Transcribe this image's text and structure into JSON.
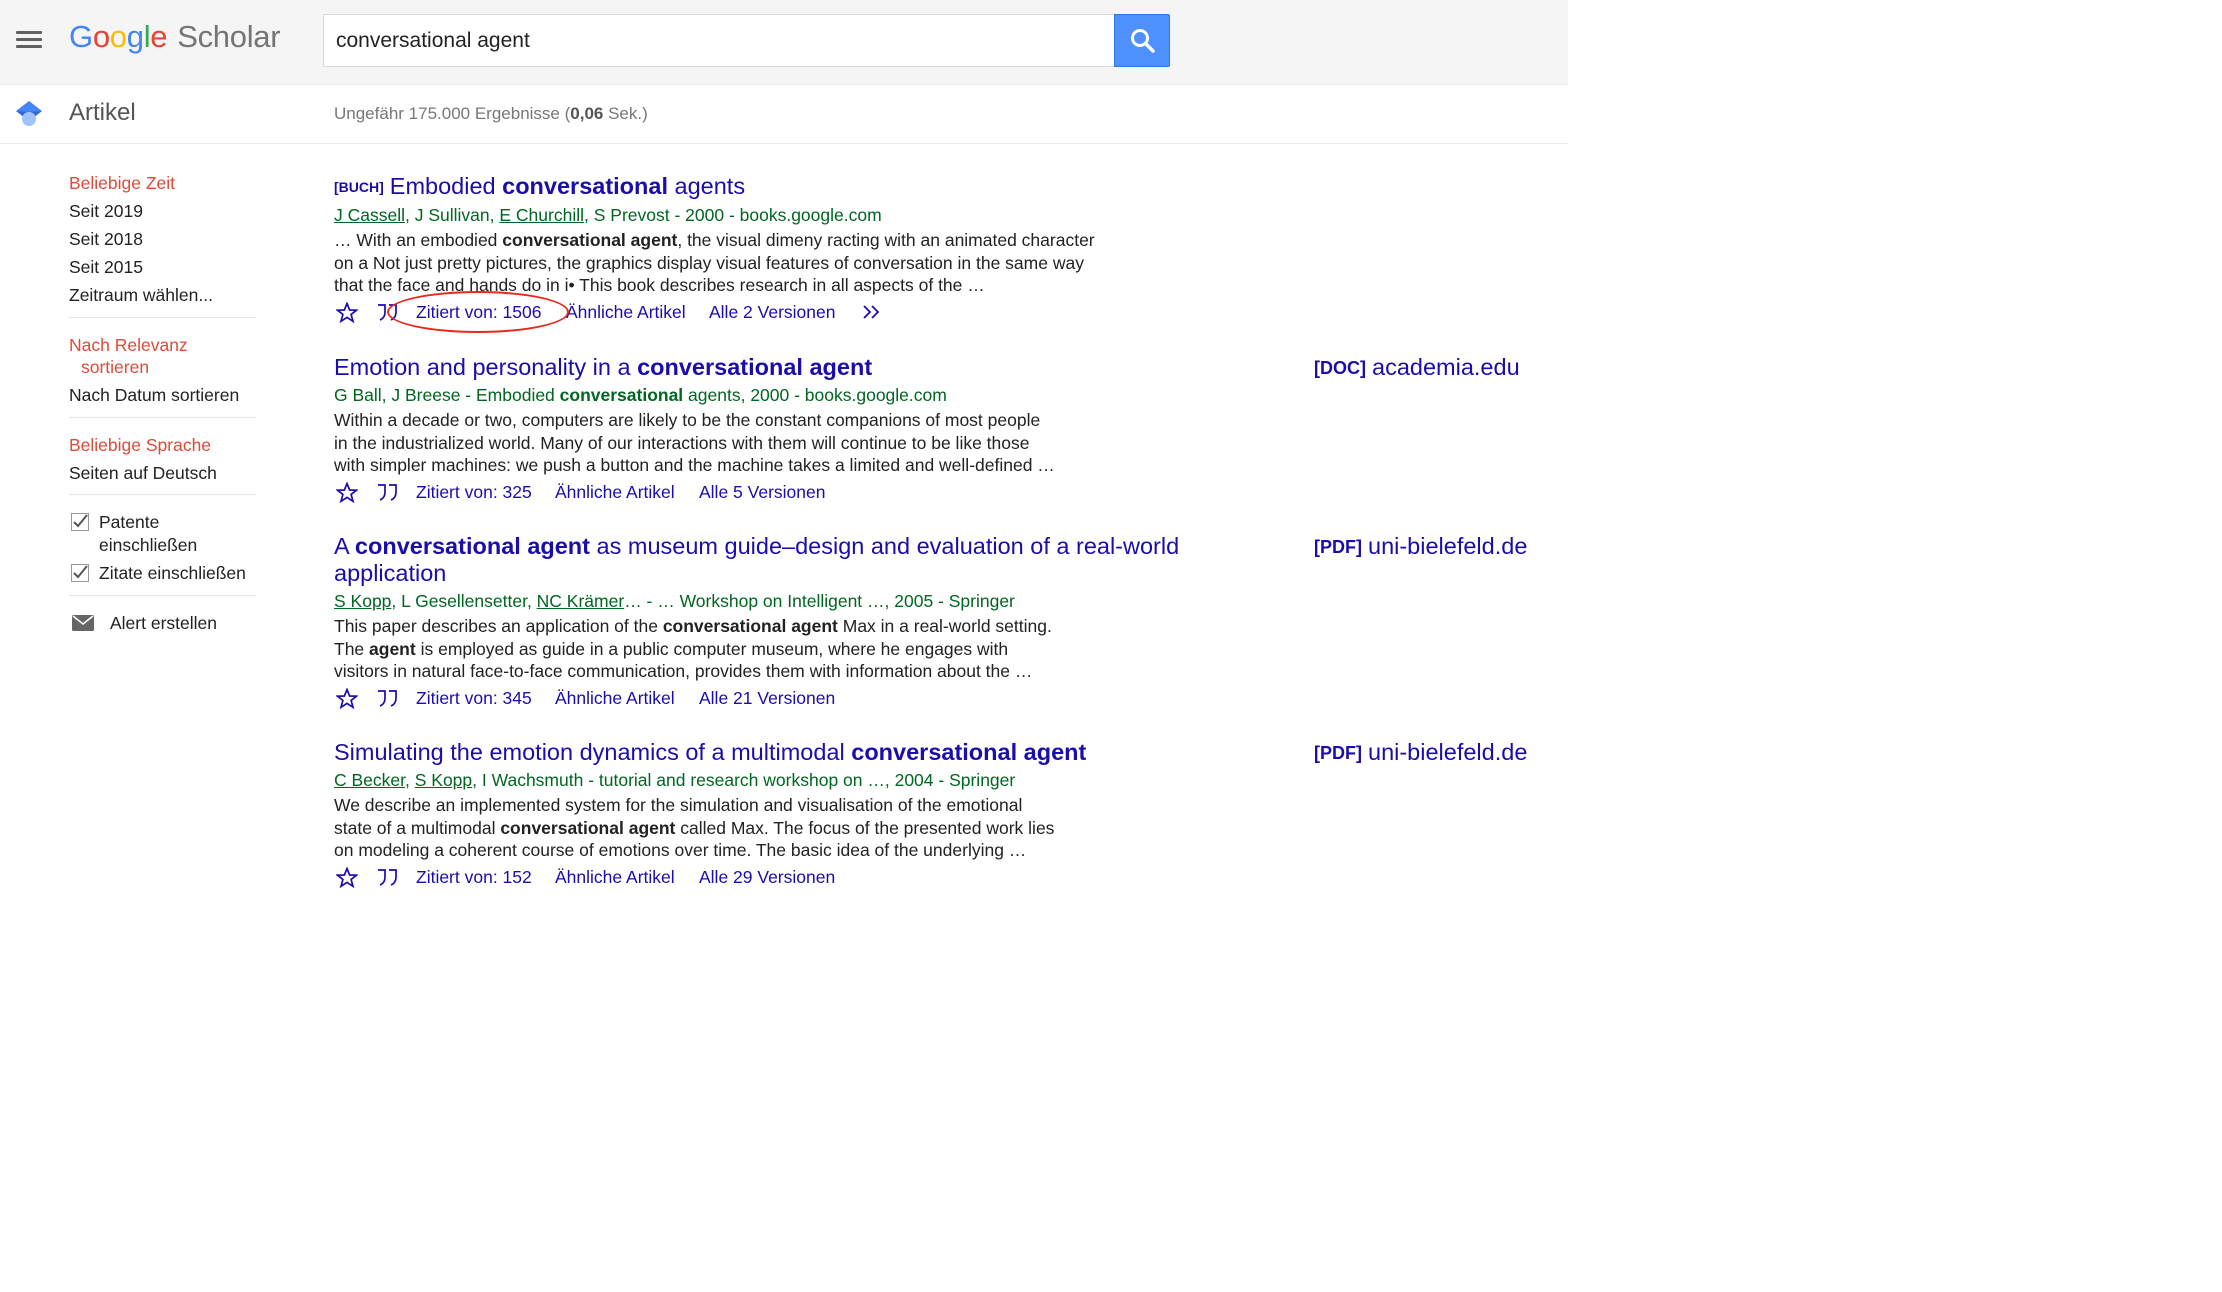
{
  "header": {
    "logo_google": "Google",
    "logo_scholar": "Scholar",
    "search_value": "conversational agent",
    "colors": {
      "blue": "#4285f4",
      "red": "#ea4335",
      "yellow": "#fbbc05",
      "green": "#34a853",
      "search_button": "#4d90fe"
    }
  },
  "subbar": {
    "title": "Artikel",
    "stats_prefix": "Ungefähr 175.000 Ergebnisse (",
    "stats_time": "0,06",
    "stats_suffix": " Sek.)"
  },
  "sidebar": {
    "time": [
      "Beliebige Zeit",
      "Seit 2019",
      "Seit 2018",
      "Seit 2015",
      "Zeitraum wählen..."
    ],
    "sort_relevance_1": "Nach Relevanz",
    "sort_relevance_2": "sortieren",
    "sort_date": "Nach Datum sortieren",
    "lang_any": "Beliebige Sprache",
    "lang_de": "Seiten auf Deutsch",
    "patents_1": "Patente",
    "patents_2": "einschließen",
    "citations": "Zitate einschließen",
    "alert": "Alert erstellen"
  },
  "results": [
    {
      "tag": "[BUCH]",
      "title_parts": [
        "Embodied ",
        "conversational",
        " agents"
      ],
      "authors": [
        "J Cassell",
        "J Sullivan",
        "E Churchill",
        "S Prevost"
      ],
      "source": " - 2000 - books.google.com",
      "snippet_lines": [
        [
          "… With an embodied ",
          "conversational agent",
          ", the visual dimeny racting with an animated character"
        ],
        [
          "on a Not just pretty pictures, the graphics display visual features of conversation in the same way"
        ],
        [
          "that the face and hands do in i• This book describes research in all aspects of the …"
        ]
      ],
      "cited": "Zitiert von: 1506",
      "related": "Ähnliche Artikel",
      "versions": "Alle 2 Versionen"
    },
    {
      "title_parts": [
        "Emotion and personality in a ",
        "conversational agent",
        ""
      ],
      "meta_parts": [
        "G Ball, J Breese - Embodied ",
        "conversational",
        " agents, 2000 - books.google.com"
      ],
      "side_tag": "[DOC]",
      "side_site": "academia.edu",
      "snippet_lines": [
        [
          "Within a decade or two, computers are likely to be the constant companions of most people"
        ],
        [
          "in the industrialized world. Many of our interactions with them will continue to be like those"
        ],
        [
          "with simpler machines: we push a button and the machine takes a limited and well-defined …"
        ]
      ],
      "cited": "Zitiert von: 325",
      "related": "Ähnliche Artikel",
      "versions": "Alle 5 Versionen"
    },
    {
      "title_parts": [
        "A ",
        "conversational agent",
        " as museum guide–design and evaluation of a real-world application"
      ],
      "authors": [
        "S Kopp",
        "NC Krämer"
      ],
      "meta_mid": ", L Gesellensetter, ",
      "source": "… - … Workshop on Intelligent …, 2005 - Springer",
      "side_tag": "[PDF]",
      "side_site": "uni-bielefeld.de",
      "snippet_lines": [
        [
          "This paper describes an application of the ",
          "conversational agent",
          " Max in a real-world setting."
        ],
        [
          "The ",
          "agent",
          " is employed as guide in a public computer museum, where he engages with"
        ],
        [
          "visitors in natural face-to-face communication, provides them with information about the …"
        ]
      ],
      "cited": "Zitiert von: 345",
      "related": "Ähnliche Artikel",
      "versions": "Alle 21 Versionen"
    },
    {
      "title_parts": [
        "Simulating the emotion dynamics of a multimodal ",
        "conversational agent",
        ""
      ],
      "authors": [
        "C Becker",
        "S Kopp"
      ],
      "source": ", I Wachsmuth - tutorial and research workshop on …, 2004 - Springer",
      "side_tag": "[PDF]",
      "side_site": "uni-bielefeld.de",
      "snippet_lines": [
        [
          "We describe an implemented system for the simulation and visualisation of the emotional"
        ],
        [
          "state of a multimodal ",
          "conversational agent",
          " called Max. The focus of the presented work lies"
        ],
        [
          "on modeling a coherent course of emotions over time. The basic idea of the underlying …"
        ]
      ],
      "cited": "Zitiert von: 152",
      "related": "Ähnliche Artikel",
      "versions": "Alle 29 Versionen"
    }
  ]
}
